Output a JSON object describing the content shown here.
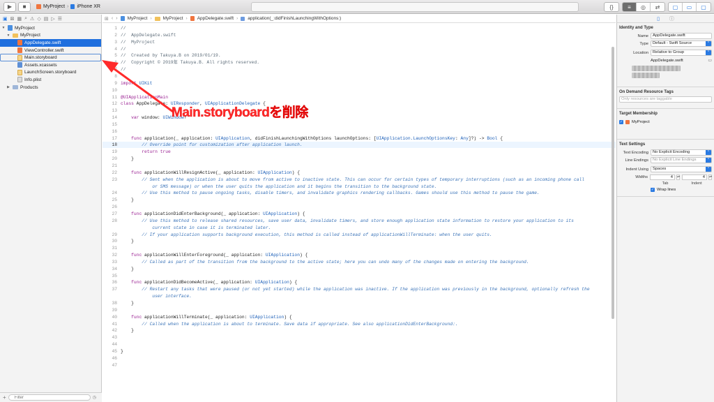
{
  "toolbar": {
    "scheme_project": "MyProject",
    "scheme_device": "iPhone XR",
    "right_buttons": [
      "{}",
      "≡",
      "◎",
      "⇄",
      "▢",
      "▭",
      "▢"
    ]
  },
  "navigator": {
    "items": [
      {
        "label": "MyProject",
        "kind": "project",
        "depth": 0,
        "expanded": true
      },
      {
        "label": "MyProject",
        "kind": "folder",
        "depth": 1,
        "expanded": true
      },
      {
        "label": "AppDelegate.swift",
        "kind": "swift",
        "depth": 2,
        "selected": true
      },
      {
        "label": "ViewController.swift",
        "kind": "swift",
        "depth": 2
      },
      {
        "label": "Main.storyboard",
        "kind": "storyboard",
        "depth": 2,
        "outlined": true
      },
      {
        "label": "Assets.xcassets",
        "kind": "asset",
        "depth": 2
      },
      {
        "label": "LaunchScreen.storyboard",
        "kind": "storyboard",
        "depth": 2
      },
      {
        "label": "Info.plist",
        "kind": "plist",
        "depth": 2
      },
      {
        "label": "Products",
        "kind": "folder-group",
        "depth": 1,
        "expanded": false
      }
    ],
    "filter_placeholder": "Filter"
  },
  "jumpbar": {
    "crumbs": [
      "MyProject",
      "MyProject",
      "AppDelegate.swift",
      "application(_:didFinishLaunchingWithOptions:)"
    ]
  },
  "code": {
    "current_line": 18,
    "lines": [
      {
        "n": "1",
        "t": "//",
        "c": "cmt"
      },
      {
        "n": "2",
        "t": "//  AppDelegate.swift",
        "c": "cmt"
      },
      {
        "n": "3",
        "t": "//  MyProject",
        "c": "cmt"
      },
      {
        "n": "4",
        "t": "//",
        "c": "cmt"
      },
      {
        "n": "5",
        "t": "//  Created by Takuya.B on 2019/01/19.",
        "c": "cmt"
      },
      {
        "n": "6",
        "t": "//  Copyright © 2019年 Takuya.B. All rights reserved.",
        "c": "cmt"
      },
      {
        "n": "7",
        "t": "//",
        "c": "cmt"
      },
      {
        "n": "8",
        "t": "",
        "c": ""
      },
      {
        "n": "9",
        "t": "import UIKit",
        "c": "import"
      },
      {
        "n": "10",
        "t": "",
        "c": ""
      },
      {
        "n": "11",
        "t": "@UIApplicationMain",
        "c": "kw"
      },
      {
        "n": "12",
        "t": "class AppDelegate: UIResponder, UIApplicationDelegate {",
        "c": "class"
      },
      {
        "n": "13",
        "t": "",
        "c": ""
      },
      {
        "n": "14",
        "t": "    var window: UIWindow?",
        "c": "var"
      },
      {
        "n": "15",
        "t": "",
        "c": ""
      },
      {
        "n": "16",
        "t": "",
        "c": ""
      },
      {
        "n": "17",
        "t": "    func application(_ application: UIApplication, didFinishLaunchingWithOptions launchOptions: [UIApplication.LaunchOptionsKey: Any]?) -> Bool {",
        "c": "func"
      },
      {
        "n": "18",
        "t": "        // Override point for customization after application launch.",
        "c": "cmtd"
      },
      {
        "n": "19",
        "t": "        return true",
        "c": "ret"
      },
      {
        "n": "20",
        "t": "    }",
        "c": ""
      },
      {
        "n": "21",
        "t": "",
        "c": ""
      },
      {
        "n": "22",
        "t": "    func applicationWillResignActive(_ application: UIApplication) {",
        "c": "func"
      },
      {
        "n": "23",
        "t": "        // Sent when the application is about to move from active to inactive state. This can occur for certain types of temporary interruptions (such as an incoming phone call",
        "c": "cmtd"
      },
      {
        "n": "",
        "t": "            or SMS message) or when the user quits the application and it begins the transition to the background state.",
        "c": "cmtd"
      },
      {
        "n": "24",
        "t": "        // Use this method to pause ongoing tasks, disable timers, and invalidate graphics rendering callbacks. Games should use this method to pause the game.",
        "c": "cmtd"
      },
      {
        "n": "25",
        "t": "    }",
        "c": ""
      },
      {
        "n": "26",
        "t": "",
        "c": ""
      },
      {
        "n": "27",
        "t": "    func applicationDidEnterBackground(_ application: UIApplication) {",
        "c": "func"
      },
      {
        "n": "28",
        "t": "        // Use this method to release shared resources, save user data, invalidate timers, and store enough application state information to restore your application to its",
        "c": "cmtd"
      },
      {
        "n": "",
        "t": "            current state in case it is terminated later.",
        "c": "cmtd"
      },
      {
        "n": "29",
        "t": "        // If your application supports background execution, this method is called instead of applicationWillTerminate: when the user quits.",
        "c": "cmtd"
      },
      {
        "n": "30",
        "t": "    }",
        "c": ""
      },
      {
        "n": "31",
        "t": "",
        "c": ""
      },
      {
        "n": "32",
        "t": "    func applicationWillEnterForeground(_ application: UIApplication) {",
        "c": "func"
      },
      {
        "n": "33",
        "t": "        // Called as part of the transition from the background to the active state; here you can undo many of the changes made on entering the background.",
        "c": "cmtd"
      },
      {
        "n": "34",
        "t": "    }",
        "c": ""
      },
      {
        "n": "35",
        "t": "",
        "c": ""
      },
      {
        "n": "36",
        "t": "    func applicationDidBecomeActive(_ application: UIApplication) {",
        "c": "func"
      },
      {
        "n": "37",
        "t": "        // Restart any tasks that were paused (or not yet started) while the application was inactive. If the application was previously in the background, optionally refresh the",
        "c": "cmtd"
      },
      {
        "n": "",
        "t": "            user interface.",
        "c": "cmtd"
      },
      {
        "n": "38",
        "t": "    }",
        "c": ""
      },
      {
        "n": "39",
        "t": "",
        "c": ""
      },
      {
        "n": "40",
        "t": "    func applicationWillTerminate(_ application: UIApplication) {",
        "c": "func"
      },
      {
        "n": "41",
        "t": "        // Called when the application is about to terminate. Save data if appropriate. See also applicationDidEnterBackground:.",
        "c": "cmtd"
      },
      {
        "n": "42",
        "t": "    }",
        "c": ""
      },
      {
        "n": "43",
        "t": "",
        "c": ""
      },
      {
        "n": "44",
        "t": "",
        "c": ""
      },
      {
        "n": "45",
        "t": "}",
        "c": ""
      },
      {
        "n": "46",
        "t": "",
        "c": ""
      },
      {
        "n": "47",
        "t": "",
        "c": ""
      }
    ]
  },
  "inspector": {
    "identity_title": "Identity and Type",
    "name_label": "Name",
    "name_value": "AppDelegate.swift",
    "type_label": "Type",
    "type_value": "Default - Swift Source",
    "location_label": "Location",
    "location_value": "Relative to Group",
    "location_file": "AppDelegate.swift",
    "odr_title": "On Demand Resource Tags",
    "odr_placeholder": "Only resources are taggable",
    "target_title": "Target Membership",
    "target_name": "MyProject",
    "text_title": "Text Settings",
    "encoding_label": "Text Encoding",
    "encoding_value": "No Explicit Encoding",
    "endings_label": "Line Endings",
    "endings_value": "No Explicit Line Endings",
    "indent_label": "Indent Using",
    "indent_value": "Spaces",
    "widths_label": "Widths",
    "tab_value": "4",
    "indent_width_value": "4",
    "tab_label": "Tab",
    "indent_sub_label": "Indent",
    "wrap_label": "Wrap lines"
  },
  "annotation": {
    "text": "Main.storyboardを削除",
    "color": "#ff2a2a"
  }
}
